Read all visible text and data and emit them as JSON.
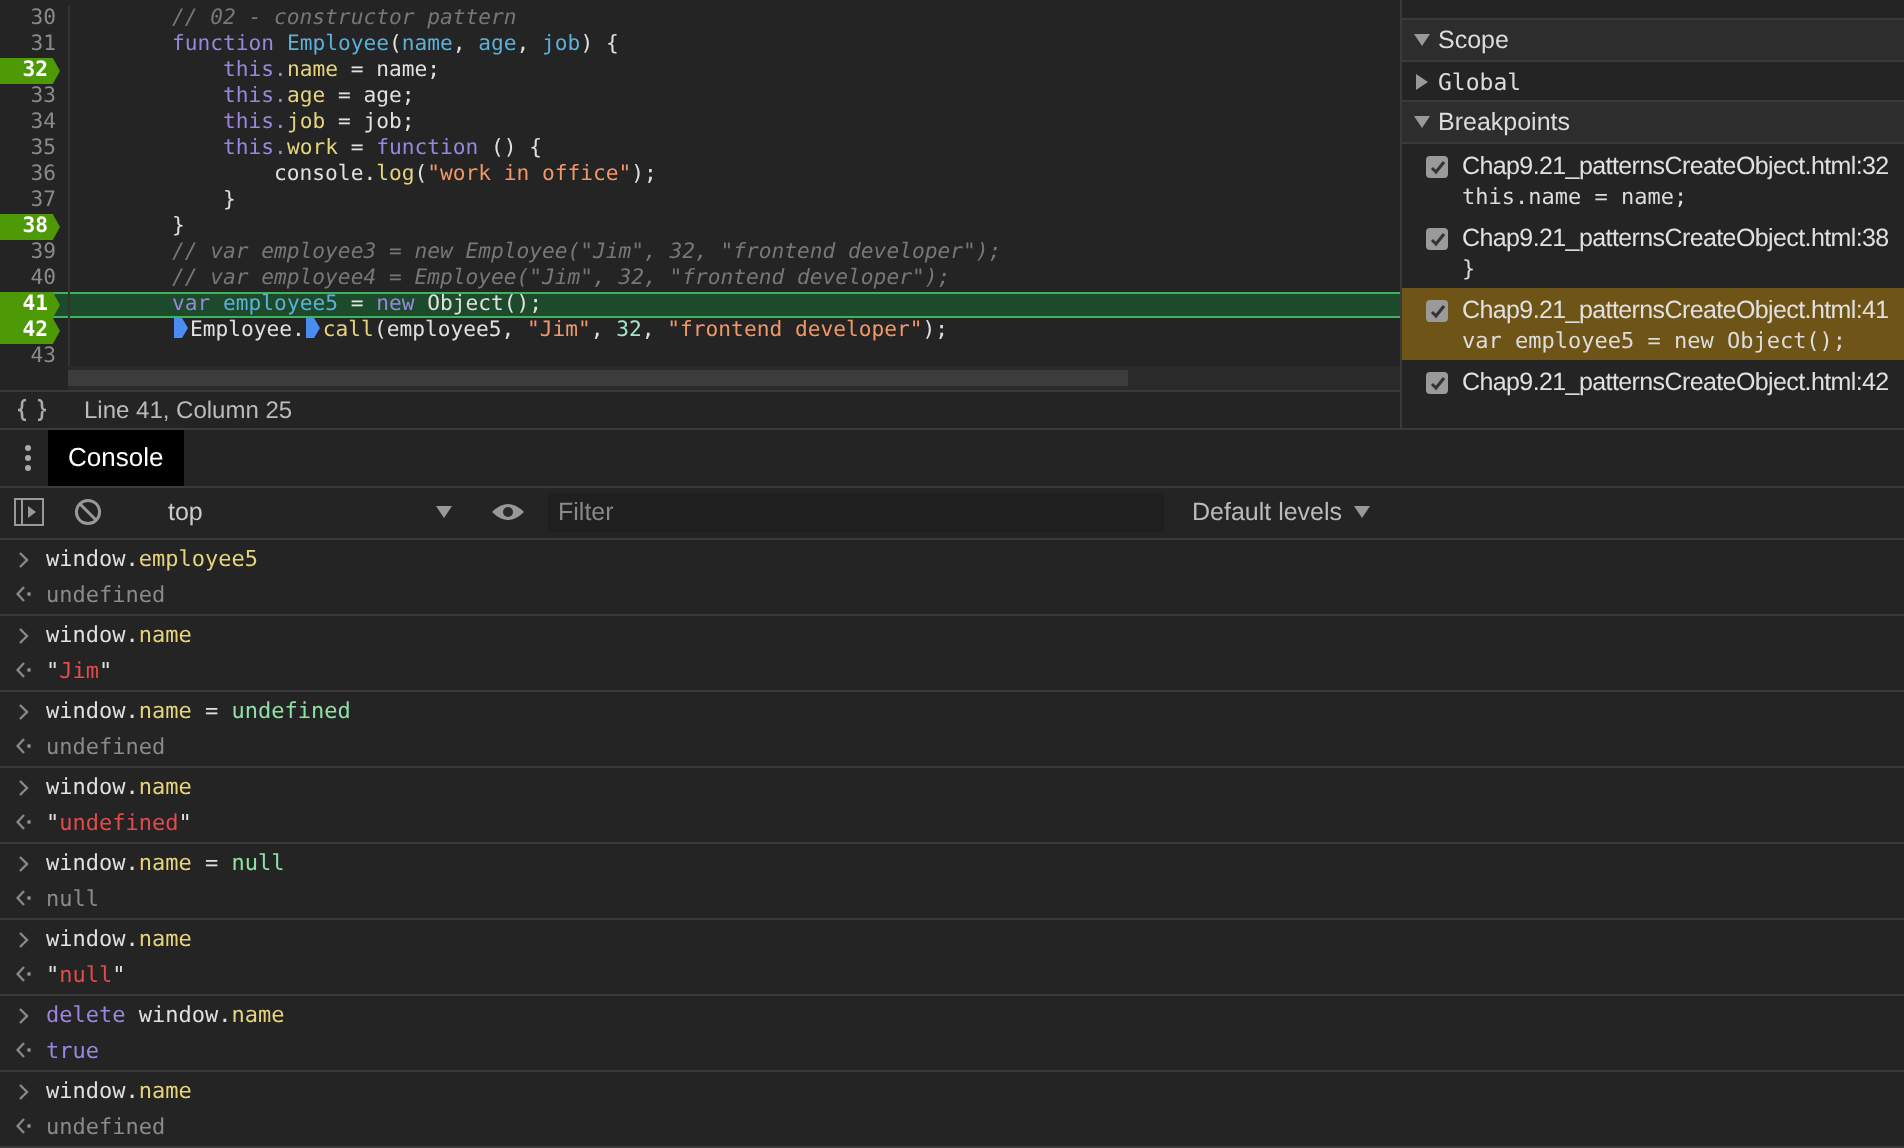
{
  "editor": {
    "lines": [
      {
        "number": "30",
        "breakpoint": false,
        "current": false,
        "tokens": [
          {
            "kind": "comment",
            "text": "        // 02 - constructor pattern"
          }
        ]
      },
      {
        "number": "31",
        "breakpoint": false,
        "current": false,
        "tokens": [
          {
            "kind": "kw",
            "text": "        function"
          },
          {
            "kind": "def",
            "text": " Employee"
          },
          {
            "kind": "plain",
            "text": "("
          },
          {
            "kind": "def",
            "text": "name"
          },
          {
            "kind": "plain",
            "text": ", "
          },
          {
            "kind": "def",
            "text": "age"
          },
          {
            "kind": "plain",
            "text": ", "
          },
          {
            "kind": "def",
            "text": "job"
          },
          {
            "kind": "plain",
            "text": ") {"
          }
        ]
      },
      {
        "number": "32",
        "breakpoint": true,
        "current": false,
        "tokens": [
          {
            "kind": "kw",
            "text": "            this."
          },
          {
            "kind": "prop",
            "text": "name"
          },
          {
            "kind": "plain",
            "text": " = name;"
          }
        ]
      },
      {
        "number": "33",
        "breakpoint": false,
        "current": false,
        "tokens": [
          {
            "kind": "kw",
            "text": "            this."
          },
          {
            "kind": "prop",
            "text": "age"
          },
          {
            "kind": "plain",
            "text": " = age;"
          }
        ]
      },
      {
        "number": "34",
        "breakpoint": false,
        "current": false,
        "tokens": [
          {
            "kind": "kw",
            "text": "            this."
          },
          {
            "kind": "prop",
            "text": "job"
          },
          {
            "kind": "plain",
            "text": " = job;"
          }
        ]
      },
      {
        "number": "35",
        "breakpoint": false,
        "current": false,
        "tokens": [
          {
            "kind": "kw",
            "text": "            this."
          },
          {
            "kind": "prop",
            "text": "work"
          },
          {
            "kind": "plain",
            "text": " = "
          },
          {
            "kind": "kw",
            "text": "function"
          },
          {
            "kind": "plain",
            "text": " () {"
          }
        ]
      },
      {
        "number": "36",
        "breakpoint": false,
        "current": false,
        "tokens": [
          {
            "kind": "plain",
            "text": "                console."
          },
          {
            "kind": "prop",
            "text": "log"
          },
          {
            "kind": "plain",
            "text": "("
          },
          {
            "kind": "str",
            "text": "\"work in office\""
          },
          {
            "kind": "plain",
            "text": ");"
          }
        ]
      },
      {
        "number": "37",
        "breakpoint": false,
        "current": false,
        "tokens": [
          {
            "kind": "plain",
            "text": "            }"
          }
        ]
      },
      {
        "number": "38",
        "breakpoint": true,
        "current": false,
        "tokens": [
          {
            "kind": "plain",
            "text": "        }"
          }
        ]
      },
      {
        "number": "39",
        "breakpoint": false,
        "current": false,
        "tokens": [
          {
            "kind": "comment",
            "text": "        // var employee3 = new Employee(\"Jim\", 32, \"frontend developer\");"
          }
        ]
      },
      {
        "number": "40",
        "breakpoint": false,
        "current": false,
        "tokens": [
          {
            "kind": "comment",
            "text": "        // var employee4 = Employee(\"Jim\", 32, \"frontend developer\");"
          }
        ]
      },
      {
        "number": "41",
        "breakpoint": true,
        "current": true,
        "tokens": [
          {
            "kind": "kw",
            "text": "        var"
          },
          {
            "kind": "def",
            "text": " employee5"
          },
          {
            "kind": "plain",
            "text": " = "
          },
          {
            "kind": "kw",
            "text": "new"
          },
          {
            "kind": "plain",
            "text": " Object();"
          }
        ]
      },
      {
        "number": "42",
        "breakpoint": true,
        "current": false,
        "tokens": [
          {
            "kind": "step"
          },
          {
            "kind": "plain",
            "text": "Employee."
          },
          {
            "kind": "step"
          },
          {
            "kind": "prop",
            "text": "call"
          },
          {
            "kind": "plain",
            "text": "(employee5, "
          },
          {
            "kind": "str",
            "text": "\"Jim\""
          },
          {
            "kind": "plain",
            "text": ", "
          },
          {
            "kind": "num",
            "text": "32"
          },
          {
            "kind": "plain",
            "text": ", "
          },
          {
            "kind": "str",
            "text": "\"frontend developer\""
          },
          {
            "kind": "plain",
            "text": ");"
          }
        ],
        "indented": true
      },
      {
        "number": "43",
        "breakpoint": false,
        "current": false
      }
    ]
  },
  "status_bar": {
    "position": "Line 41, Column 25"
  },
  "sidebar": {
    "sections": [
      {
        "title": "Scope",
        "expanded": true,
        "kind": "header"
      },
      {
        "title": "Global",
        "expanded": false,
        "kind": "scope"
      },
      {
        "title": "Breakpoints",
        "expanded": true,
        "kind": "header"
      }
    ],
    "breakpoints": [
      {
        "label": "Chap9.21_patternsCreateObject.html:32",
        "code": "this.name = name;",
        "checked": true,
        "selected": false
      },
      {
        "label": "Chap9.21_patternsCreateObject.html:38",
        "code": "}",
        "checked": true,
        "selected": false
      },
      {
        "label": "Chap9.21_patternsCreateObject.html:41",
        "code": "var employee5 = new Object();",
        "checked": true,
        "selected": true
      },
      {
        "label": "Chap9.21_patternsCreateObject.html:42",
        "checked": true,
        "selected": false
      }
    ]
  },
  "drawer": {
    "tabs": [
      {
        "label": "Console",
        "selected": true
      }
    ]
  },
  "console_toolbar": {
    "context": "top",
    "filter_placeholder": "Filter",
    "levels": "Default levels"
  },
  "console": [
    {
      "input": [
        {
          "kind": "plain",
          "text": "window."
        },
        {
          "kind": "prop",
          "text": "employee5"
        }
      ],
      "output": [
        {
          "kind": "dim",
          "text": "undefined"
        }
      ]
    },
    {
      "input": [
        {
          "kind": "plain",
          "text": "window."
        },
        {
          "kind": "prop",
          "text": "name"
        }
      ],
      "output": [
        {
          "kind": "plain",
          "text": "\""
        },
        {
          "kind": "red",
          "text": "Jim"
        },
        {
          "kind": "plain",
          "text": "\""
        }
      ]
    },
    {
      "input": [
        {
          "kind": "plain",
          "text": "window."
        },
        {
          "kind": "prop",
          "text": "name"
        },
        {
          "kind": "plain",
          "text": " = "
        },
        {
          "kind": "green",
          "text": "undefined"
        }
      ],
      "output": [
        {
          "kind": "dim",
          "text": "undefined"
        }
      ]
    },
    {
      "input": [
        {
          "kind": "plain",
          "text": "window."
        },
        {
          "kind": "prop",
          "text": "name"
        }
      ],
      "output": [
        {
          "kind": "plain",
          "text": "\""
        },
        {
          "kind": "red",
          "text": "undefined"
        },
        {
          "kind": "plain",
          "text": "\""
        }
      ]
    },
    {
      "input": [
        {
          "kind": "plain",
          "text": "window."
        },
        {
          "kind": "prop",
          "text": "name"
        },
        {
          "kind": "plain",
          "text": " = "
        },
        {
          "kind": "green",
          "text": "null"
        }
      ],
      "output": [
        {
          "kind": "dim",
          "text": "null"
        }
      ]
    },
    {
      "input": [
        {
          "kind": "plain",
          "text": "window."
        },
        {
          "kind": "prop",
          "text": "name"
        }
      ],
      "output": [
        {
          "kind": "plain",
          "text": "\""
        },
        {
          "kind": "red",
          "text": "null"
        },
        {
          "kind": "plain",
          "text": "\""
        }
      ]
    },
    {
      "input": [
        {
          "kind": "kw",
          "text": "delete"
        },
        {
          "kind": "plain",
          "text": " window."
        },
        {
          "kind": "prop",
          "text": "name"
        }
      ],
      "output": [
        {
          "kind": "kw",
          "text": "true"
        }
      ]
    },
    {
      "input": [
        {
          "kind": "plain",
          "text": "window."
        },
        {
          "kind": "prop",
          "text": "name"
        }
      ],
      "output": [
        {
          "kind": "dim",
          "text": "undefined"
        }
      ]
    }
  ]
}
